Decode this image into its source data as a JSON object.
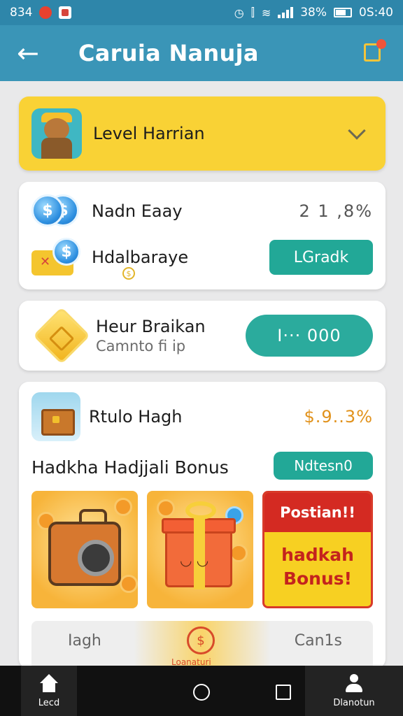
{
  "status_bar": {
    "time_left": "834",
    "battery": "38%",
    "time_right": "0S:40"
  },
  "app_bar": {
    "title": "Caruia Nanuja",
    "back_icon": "arrow-left-icon",
    "action_icon": "document-badge-icon"
  },
  "level_card": {
    "label": "Level Harrian",
    "icon": "monkey-avatar-icon"
  },
  "rewards_card": {
    "row1": {
      "label": "Nadn Eaay",
      "value": "2 1 ,8%"
    },
    "row2": {
      "label": "Hdalbaraye",
      "button": "LGradk"
    }
  },
  "redeem_card": {
    "title": "Heur Braikan",
    "subtitle": "Camnto fi ip",
    "button": "I···  000"
  },
  "bonus_card": {
    "header_label": "Rtulo Hagh",
    "header_value": "$.9..3%",
    "section_title": "Hadkha Hadjjali Bonus",
    "section_button": "Ndtesn0",
    "tiles": [
      {
        "name": "camera",
        "icon": "camera-chest-icon"
      },
      {
        "name": "gift",
        "icon": "gift-box-icon"
      },
      {
        "name": "promo",
        "banner": "Postian!!",
        "line1": "hadkah",
        "line2": "Bonus!"
      }
    ],
    "footer": {
      "left": "Iagh",
      "middle_label": "Loanaturi",
      "right": "Can1s"
    }
  },
  "nav_bar": {
    "home_label": "Lecd",
    "profile_label": "Dlanotun"
  }
}
